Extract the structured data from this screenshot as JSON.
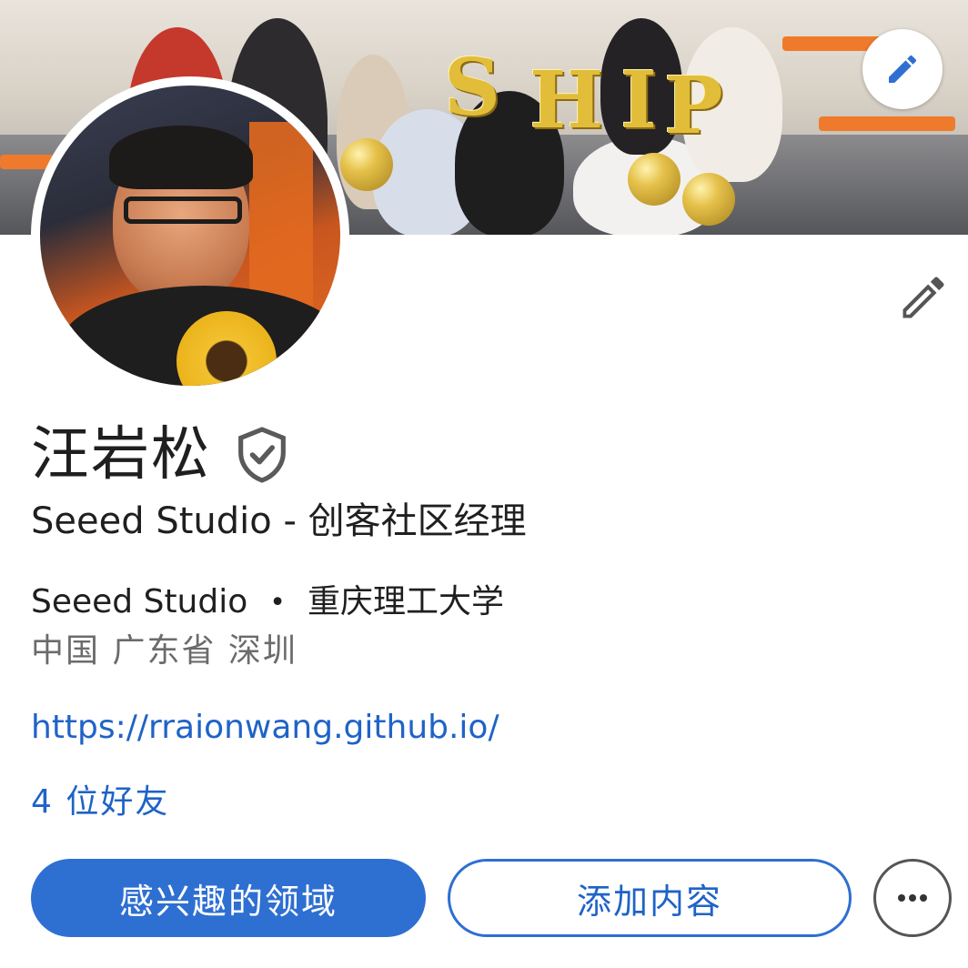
{
  "cover": {
    "balloon_letters": [
      "S",
      "H",
      "I",
      "P"
    ]
  },
  "profile": {
    "name": "汪岩松",
    "headline": "Seeed Studio - 创客社区经理",
    "company": "Seeed Studio",
    "separator": "•",
    "school": "重庆理工大学",
    "location": "中国 广东省 深圳",
    "website": "https://rraionwang.github.io/",
    "friends": "4 位好友"
  },
  "actions": {
    "primary_label": "感兴趣的领域",
    "secondary_label": "添加内容",
    "more_label": "•••"
  },
  "icons": {
    "cover_edit": "pencil-icon",
    "profile_edit": "pencil-icon",
    "verified": "shield-check-icon",
    "more": "ellipsis-icon"
  },
  "colors": {
    "accent": "#2e6fd2",
    "link": "#1f63c7",
    "text": "#1f1f1f",
    "muted": "#6b6b6b"
  }
}
